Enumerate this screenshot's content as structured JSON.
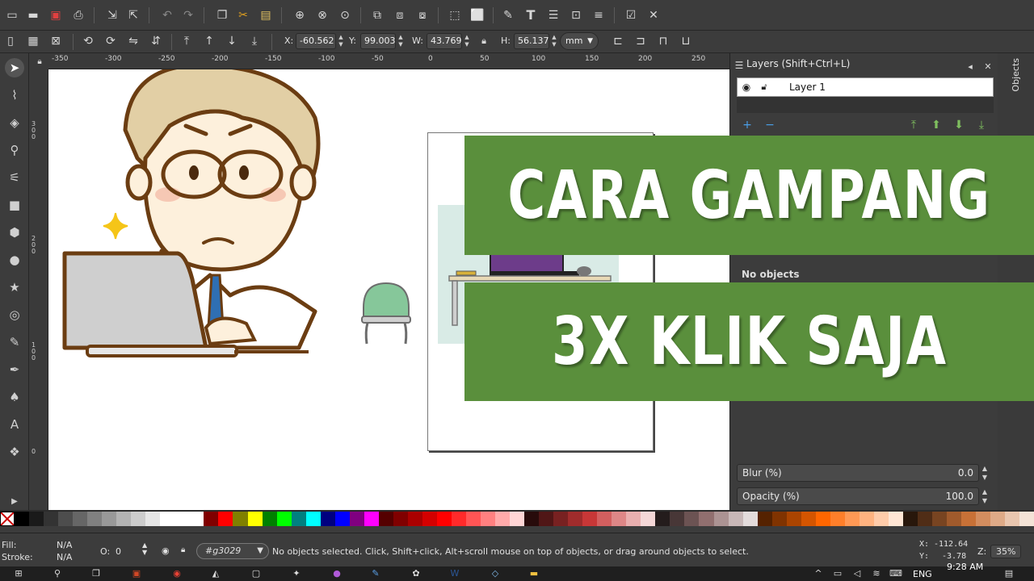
{
  "toolbar": {
    "x_label": "X:",
    "x_value": "-60.562",
    "y_label": "Y:",
    "y_value": "99.003",
    "w_label": "W:",
    "w_value": "43.769",
    "h_label": "H:",
    "h_value": "56.137",
    "unit": "mm"
  },
  "ruler_top": {
    "ticks": [
      "-350",
      "-300",
      "-250",
      "-200",
      "-150",
      "-100",
      "-50",
      "0",
      "50",
      "100",
      "150",
      "200",
      "250"
    ]
  },
  "ruler_left": {
    "ticks": [
      "300",
      "200",
      "100",
      "0"
    ]
  },
  "layers_panel": {
    "title": "Layers (Shift+Ctrl+L)",
    "layer_name": "Layer 1",
    "no_objects": "No objects",
    "blur_label": "Blur (%)",
    "blur_value": "0.0",
    "opacity_label": "Opacity (%)",
    "opacity_value": "100.0"
  },
  "objects_tab": "Objects",
  "banners": {
    "top": "CARA GAMPANG",
    "bottom": "3X KLIK SAJA"
  },
  "palette": {
    "colors": [
      "#000000",
      "#1a1a1a",
      "#333333",
      "#4d4d4d",
      "#666666",
      "#808080",
      "#999999",
      "#b3b3b3",
      "#cccccc",
      "#e6e6e6",
      "#ffffff",
      "#ffffff",
      "#ffffff",
      "#800000",
      "#ff0000",
      "#808000",
      "#ffff00",
      "#008000",
      "#00ff00",
      "#008080",
      "#00ffff",
      "#000080",
      "#0000ff",
      "#800080",
      "#ff00ff",
      "#550000",
      "#800000",
      "#aa0000",
      "#d40000",
      "#ff0000",
      "#ff2a2a",
      "#ff5555",
      "#ff8080",
      "#ffaaaa",
      "#ffd5d5",
      "#280b0b",
      "#501616",
      "#782121",
      "#a02c2c",
      "#c83737",
      "#d35f5f",
      "#de8787",
      "#e9afaf",
      "#f4d7d7",
      "#241c1c",
      "#483737",
      "#6c5353",
      "#916f6f",
      "#ac9393",
      "#c8b7b7",
      "#e3dbdb",
      "#552200",
      "#803300",
      "#aa4400",
      "#d45500",
      "#ff6600",
      "#ff7f2a",
      "#ff9955",
      "#ffb380",
      "#ffccaa",
      "#ffe6d5",
      "#28170b",
      "#502d16",
      "#784421",
      "#a05a2c",
      "#c87137",
      "#d38d5f",
      "#deaa87",
      "#e9c6af",
      "#f4e3d7"
    ]
  },
  "statusbar": {
    "fill_label": "Fill:",
    "fill_value": "N/A",
    "stroke_label": "Stroke:",
    "stroke_value": "N/A",
    "opacity_label": "O:",
    "opacity_value": "0",
    "layer_id": "#g3029",
    "message": "No objects selected. Click, Shift+click, Alt+scroll mouse on top of objects, or drag around objects to select.",
    "cursor_x_label": "X:",
    "cursor_x": "-112.64",
    "cursor_y_label": "Y:",
    "cursor_y": "-3.78",
    "zoom_label": "Z:",
    "zoom": "35%"
  },
  "taskbar": {
    "lang": "ENG",
    "time": "9:28 AM"
  }
}
